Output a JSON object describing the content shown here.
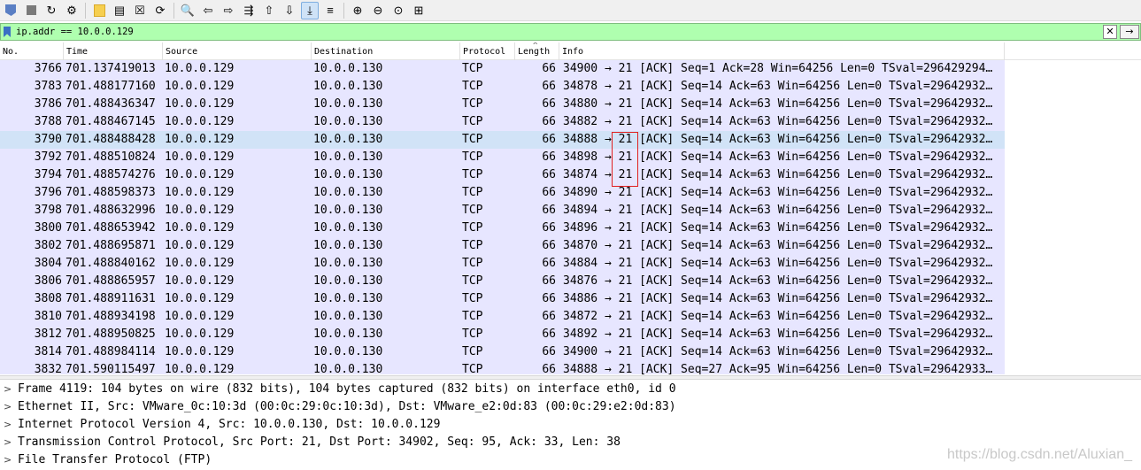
{
  "toolbar": {
    "buttons": [
      {
        "name": "start-capture-icon",
        "glyph": "◢"
      },
      {
        "name": "stop-capture-icon",
        "glyph": "■"
      },
      {
        "name": "restart-capture-icon",
        "glyph": "↻"
      },
      {
        "name": "capture-options-icon",
        "glyph": "⚙"
      },
      {
        "name": "open-file-icon",
        "glyph": ""
      },
      {
        "name": "save-file-icon",
        "glyph": "▤"
      },
      {
        "name": "close-file-icon",
        "glyph": "☒"
      },
      {
        "name": "reload-file-icon",
        "glyph": "⟳"
      },
      {
        "name": "find-packet-icon",
        "glyph": "🔍"
      },
      {
        "name": "go-back-icon",
        "glyph": "⇦"
      },
      {
        "name": "go-forward-icon",
        "glyph": "⇨"
      },
      {
        "name": "go-to-packet-icon",
        "glyph": "⇶"
      },
      {
        "name": "go-first-icon",
        "glyph": "⇧"
      },
      {
        "name": "go-last-icon",
        "glyph": "⇩"
      },
      {
        "name": "auto-scroll-icon",
        "glyph": "⤓"
      },
      {
        "name": "colorize-icon",
        "glyph": "≡"
      },
      {
        "name": "zoom-in-icon",
        "glyph": "⊕"
      },
      {
        "name": "zoom-out-icon",
        "glyph": "⊖"
      },
      {
        "name": "zoom-normal-icon",
        "glyph": "⊙"
      },
      {
        "name": "resize-columns-icon",
        "glyph": "⊞"
      }
    ]
  },
  "filter": {
    "value": "ip.addr == 10.0.0.129",
    "clear_glyph": "✕",
    "apply_glyph": "→"
  },
  "columns": {
    "no": "No.",
    "time": "Time",
    "source": "Source",
    "destination": "Destination",
    "protocol": "Protocol",
    "length": "Length",
    "info": "Info",
    "sort_glyph": "^"
  },
  "packets": [
    {
      "no": "3766",
      "time": "701.137419013",
      "src": "10.0.0.129",
      "dst": "10.0.0.130",
      "proto": "TCP",
      "len": "66",
      "info": "34900 → 21 [ACK] Seq=1 Ack=28 Win=64256 Len=0 TSval=296429294…"
    },
    {
      "no": "3783",
      "time": "701.488177160",
      "src": "10.0.0.129",
      "dst": "10.0.0.130",
      "proto": "TCP",
      "len": "66",
      "info": "34878 → 21 [ACK] Seq=14 Ack=63 Win=64256 Len=0 TSval=29642932…"
    },
    {
      "no": "3786",
      "time": "701.488436347",
      "src": "10.0.0.129",
      "dst": "10.0.0.130",
      "proto": "TCP",
      "len": "66",
      "info": "34880 → 21 [ACK] Seq=14 Ack=63 Win=64256 Len=0 TSval=29642932…"
    },
    {
      "no": "3788",
      "time": "701.488467145",
      "src": "10.0.0.129",
      "dst": "10.0.0.130",
      "proto": "TCP",
      "len": "66",
      "info": "34882 → 21 [ACK] Seq=14 Ack=63 Win=64256 Len=0 TSval=29642932…"
    },
    {
      "no": "3790",
      "time": "701.488488428",
      "src": "10.0.0.129",
      "dst": "10.0.0.130",
      "proto": "TCP",
      "len": "66",
      "info": "34888 → 21 [ACK] Seq=14 Ack=63 Win=64256 Len=0 TSval=29642932…"
    },
    {
      "no": "3792",
      "time": "701.488510824",
      "src": "10.0.0.129",
      "dst": "10.0.0.130",
      "proto": "TCP",
      "len": "66",
      "info": "34898 → 21 [ACK] Seq=14 Ack=63 Win=64256 Len=0 TSval=29642932…"
    },
    {
      "no": "3794",
      "time": "701.488574276",
      "src": "10.0.0.129",
      "dst": "10.0.0.130",
      "proto": "TCP",
      "len": "66",
      "info": "34874 → 21 [ACK] Seq=14 Ack=63 Win=64256 Len=0 TSval=29642932…"
    },
    {
      "no": "3796",
      "time": "701.488598373",
      "src": "10.0.0.129",
      "dst": "10.0.0.130",
      "proto": "TCP",
      "len": "66",
      "info": "34890 → 21 [ACK] Seq=14 Ack=63 Win=64256 Len=0 TSval=29642932…"
    },
    {
      "no": "3798",
      "time": "701.488632996",
      "src": "10.0.0.129",
      "dst": "10.0.0.130",
      "proto": "TCP",
      "len": "66",
      "info": "34894 → 21 [ACK] Seq=14 Ack=63 Win=64256 Len=0 TSval=29642932…"
    },
    {
      "no": "3800",
      "time": "701.488653942",
      "src": "10.0.0.129",
      "dst": "10.0.0.130",
      "proto": "TCP",
      "len": "66",
      "info": "34896 → 21 [ACK] Seq=14 Ack=63 Win=64256 Len=0 TSval=29642932…"
    },
    {
      "no": "3802",
      "time": "701.488695871",
      "src": "10.0.0.129",
      "dst": "10.0.0.130",
      "proto": "TCP",
      "len": "66",
      "info": "34870 → 21 [ACK] Seq=14 Ack=63 Win=64256 Len=0 TSval=29642932…"
    },
    {
      "no": "3804",
      "time": "701.488840162",
      "src": "10.0.0.129",
      "dst": "10.0.0.130",
      "proto": "TCP",
      "len": "66",
      "info": "34884 → 21 [ACK] Seq=14 Ack=63 Win=64256 Len=0 TSval=29642932…"
    },
    {
      "no": "3806",
      "time": "701.488865957",
      "src": "10.0.0.129",
      "dst": "10.0.0.130",
      "proto": "TCP",
      "len": "66",
      "info": "34876 → 21 [ACK] Seq=14 Ack=63 Win=64256 Len=0 TSval=29642932…"
    },
    {
      "no": "3808",
      "time": "701.488911631",
      "src": "10.0.0.129",
      "dst": "10.0.0.130",
      "proto": "TCP",
      "len": "66",
      "info": "34886 → 21 [ACK] Seq=14 Ack=63 Win=64256 Len=0 TSval=29642932…"
    },
    {
      "no": "3810",
      "time": "701.488934198",
      "src": "10.0.0.129",
      "dst": "10.0.0.130",
      "proto": "TCP",
      "len": "66",
      "info": "34872 → 21 [ACK] Seq=14 Ack=63 Win=64256 Len=0 TSval=29642932…"
    },
    {
      "no": "3812",
      "time": "701.488950825",
      "src": "10.0.0.129",
      "dst": "10.0.0.130",
      "proto": "TCP",
      "len": "66",
      "info": "34892 → 21 [ACK] Seq=14 Ack=63 Win=64256 Len=0 TSval=29642932…"
    },
    {
      "no": "3814",
      "time": "701.488984114",
      "src": "10.0.0.129",
      "dst": "10.0.0.130",
      "proto": "TCP",
      "len": "66",
      "info": "34900 → 21 [ACK] Seq=14 Ack=63 Win=64256 Len=0 TSval=29642932…"
    },
    {
      "no": "3832",
      "time": "701.590115497",
      "src": "10.0.0.129",
      "dst": "10.0.0.130",
      "proto": "TCP",
      "len": "66",
      "info": "34888 → 21 [ACK] Seq=27 Ack=95 Win=64256 Len=0 TSval=29642933…"
    }
  ],
  "details": {
    "caret": ">",
    "lines": [
      "Frame 4119: 104 bytes on wire (832 bits), 104 bytes captured (832 bits) on interface eth0, id 0",
      "Ethernet II, Src: VMware_0c:10:3d (00:0c:29:0c:10:3d), Dst: VMware_e2:0d:83 (00:0c:29:e2:0d:83)",
      "Internet Protocol Version 4, Src: 10.0.0.130, Dst: 10.0.0.129",
      "Transmission Control Protocol, Src Port: 21, Dst Port: 34902, Seq: 95, Ack: 33, Len: 38",
      "File Transfer Protocol (FTP)"
    ]
  },
  "watermark": "https://blog.csdn.net/Aluxian_",
  "colors": {
    "filter_valid_bg": "#afffaf",
    "tcp_row_bg": "#e7e6ff",
    "selected_row_bg": "#d1e3f7",
    "highlight_box": "#e02020"
  }
}
